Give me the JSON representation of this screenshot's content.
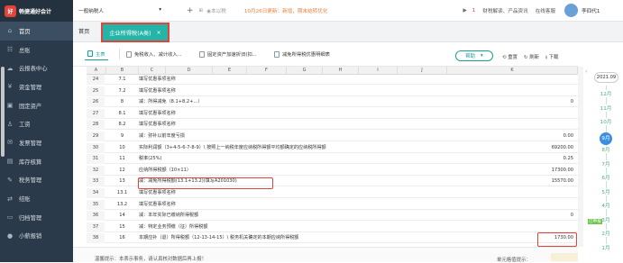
{
  "app": {
    "logo_text": "畅捷通好会计",
    "logo_mark": "好"
  },
  "sidebar": {
    "items": [
      {
        "icon": "⌂",
        "label": "首页",
        "icon_name": "home-icon"
      },
      {
        "icon": "☷",
        "label": "总账",
        "icon_name": "ledger-icon"
      },
      {
        "icon": "☁",
        "label": "云报表中心",
        "icon_name": "cloud-icon"
      },
      {
        "icon": "¥",
        "label": "资金管理",
        "icon_name": "money-icon"
      },
      {
        "icon": "▣",
        "label": "固定资产",
        "icon_name": "asset-icon"
      },
      {
        "icon": "♙",
        "label": "工资",
        "icon_name": "salary-icon"
      },
      {
        "icon": "✉",
        "label": "发票管理",
        "icon_name": "invoice-icon"
      },
      {
        "icon": "▤",
        "label": "库存核算",
        "icon_name": "inventory-icon"
      },
      {
        "icon": "✎",
        "label": "税务管理",
        "icon_name": "tax-icon"
      },
      {
        "icon": "⇄",
        "label": "结账",
        "icon_name": "closing-icon"
      },
      {
        "icon": "▭",
        "label": "归档管理",
        "icon_name": "archive-icon"
      },
      {
        "icon": "●",
        "label": "小薪报销",
        "icon_name": "reimburse-icon"
      }
    ]
  },
  "topbar": {
    "company": "一般纳税人",
    "company_arrow": "▾",
    "plus": "+",
    "grid_icon": "⊞",
    "period": "◉本以税",
    "notice": "10月26日更新：新增，期末结转优化",
    "notice_mid": "▶",
    "alert_count": "1",
    "news": "财税解读、产品资讯",
    "service": "在线客服",
    "user": "李四代1"
  },
  "tabs": {
    "home": "首页",
    "active": "企业所得税(A类)",
    "close": "×"
  },
  "subtabs": [
    "主表",
    "免税收入、减计收入...",
    "固定资产加速折旧(扣...",
    "减免所得税优惠明细表"
  ],
  "toolbar": {
    "apply": "帮助",
    "apply_arrow": "▾",
    "reset": "重置",
    "refresh": "刷新",
    "download": "下载"
  },
  "sheet": {
    "columns": [
      "A",
      "B",
      "C",
      "D",
      "E",
      "F",
      "G",
      "H",
      "I",
      "J",
      "K"
    ],
    "rows": [
      {
        "n": "24",
        "a": "7.1",
        "b": "填写优惠事项名称",
        "k": ""
      },
      {
        "n": "25",
        "a": "7.2",
        "b": "填写优惠事项名称",
        "k": ""
      },
      {
        "n": "26",
        "a": "8",
        "b": "减：所得减免（8.1+8.2+…）",
        "k": "0"
      },
      {
        "n": "27",
        "a": "8.1",
        "b": "填写优惠事项名称",
        "k": ""
      },
      {
        "n": "28",
        "a": "8.2",
        "b": "填写优惠事项名称",
        "k": ""
      },
      {
        "n": "29",
        "a": "9",
        "b": "减：弥补以前年度亏损",
        "k": "0.00"
      },
      {
        "n": "30",
        "a": "10",
        "b": "实际利润额（3+4-5-6-7-8-9）\\ 按照上一纳税年度应纳税所得额平均额确定的应纳税所得额",
        "k": "69200.00"
      },
      {
        "n": "31",
        "a": "11",
        "b": "税率(25%)",
        "k": "0.25"
      },
      {
        "n": "32",
        "a": "12",
        "b": "应纳所得税额（10×11）",
        "k": "17300.00"
      },
      {
        "n": "33",
        "a": "13",
        "b": "减：减免所得税额(13.1+13.2)(填写A201030)",
        "k": "15570.00"
      },
      {
        "n": "34",
        "a": "13.1",
        "b": "填写优惠事项名称",
        "k": ""
      },
      {
        "n": "35",
        "a": "13.2",
        "b": "填写优惠事项名称",
        "k": ""
      },
      {
        "n": "36",
        "a": "14",
        "b": "减：本年实际已缴纳所得税额",
        "k": "0"
      },
      {
        "n": "37",
        "a": "15",
        "b": "减：特定业务预缴（征）所得税额",
        "k": ""
      },
      {
        "n": "38",
        "a": "16",
        "b": "本期应补（退）所得税额（12-13-14-15）\\ 税务机关确定的本期应纳所得税额",
        "k": "1730.00"
      }
    ]
  },
  "footer": {
    "tip": "温馨提示：本表示事务，请认真核对数据后再上报！",
    "unit": "单元格值提示："
  },
  "timeline": {
    "year": "2021.09",
    "arrow": "‹",
    "months": [
      "12月",
      "11月",
      "10月",
      "9月",
      "8月",
      "7月",
      "6月",
      "5月",
      "4月",
      "3月",
      "2月",
      "1月"
    ],
    "selected": "9月",
    "badge": "已申报"
  },
  "colors": {
    "accent": "#25b4a8",
    "highlight": "#e2433a",
    "sidebar": "#2b3a4a"
  }
}
